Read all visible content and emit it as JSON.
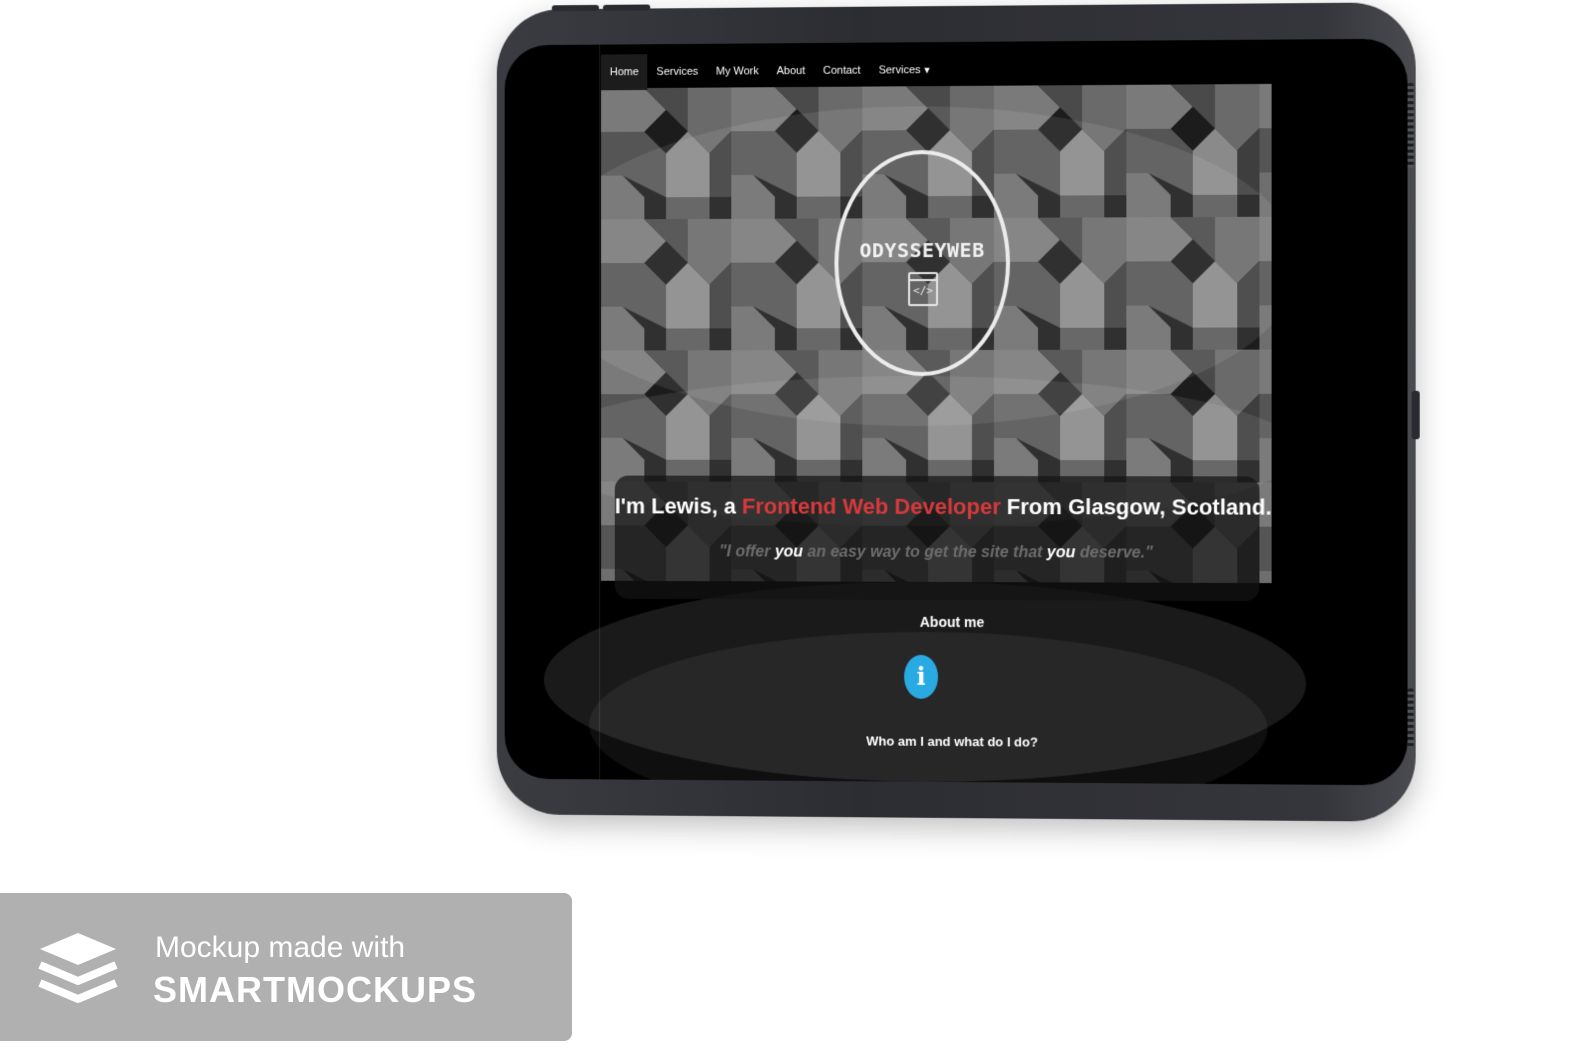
{
  "nav": {
    "items": [
      {
        "label": "Home",
        "active": true
      },
      {
        "label": "Services",
        "active": false
      },
      {
        "label": "My Work",
        "active": false
      },
      {
        "label": "About",
        "active": false
      },
      {
        "label": "Contact",
        "active": false
      }
    ],
    "dropdown_label": "Services",
    "dropdown_icon": "caret-down-icon"
  },
  "hero": {
    "logo_text": "ODYSSEYWEB",
    "logo_icon": "code-window-icon",
    "logo_icon_glyph": "</>",
    "headline_prefix": "I'm Lewis, a ",
    "headline_accent": "Frontend Web Developer",
    "headline_suffix": " From Glasgow, Scotland.",
    "tagline_part1": "\"I offer ",
    "tagline_em1": "you",
    "tagline_part2": " an easy way to get the site that ",
    "tagline_em2": "you",
    "tagline_part3": " deserve.\""
  },
  "about": {
    "title": "About me",
    "icon": "info-icon",
    "icon_glyph": "i",
    "subtitle": "Who am I and what do I do?"
  },
  "watermark": {
    "line1": "Mockup made with",
    "line2": "SMARTMOCKUPS",
    "icon": "layers-icon"
  },
  "colors": {
    "accent_red": "#d8393c",
    "info_blue": "#29aae3",
    "badge_gray": "#b0b0b0"
  }
}
